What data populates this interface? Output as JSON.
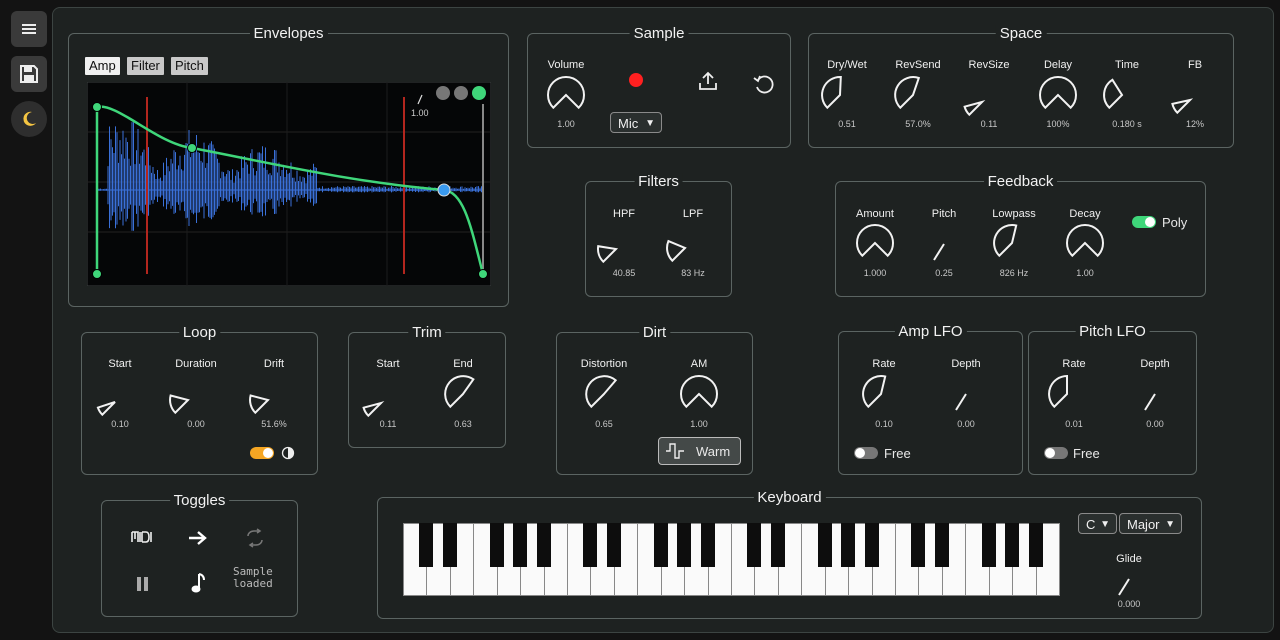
{
  "colors": {
    "accent_green": "#3fd67a",
    "accent_blue": "#3a9af0",
    "record_red": "#ff2020",
    "toggle_orange": "#f5a623",
    "waveform": "#3a70d8",
    "marker_red": "#b3261e"
  },
  "sidebar": {
    "menu_icon": "hamburger-icon",
    "save_icon": "floppy-disk-icon",
    "theme_icon": "crescent-moon-icon"
  },
  "envelopes": {
    "title": "Envelopes",
    "tabs": [
      "Amp",
      "Filter",
      "Pitch"
    ],
    "active_tab": "Amp",
    "readout": "1.00"
  },
  "sample": {
    "title": "Sample",
    "volume_label": "Volume",
    "volume_value": "1.00",
    "source": "Mic",
    "record_icon": "record-icon",
    "upload_icon": "upload-icon",
    "undo_icon": "undo-icon"
  },
  "space": {
    "title": "Space",
    "knobs": [
      {
        "label": "Dry/Wet",
        "value": "0.51"
      },
      {
        "label": "RevSend",
        "value": "57.0%"
      },
      {
        "label": "RevSize",
        "value": "0.11"
      },
      {
        "label": "Delay",
        "value": "100%"
      },
      {
        "label": "Time",
        "value": "0.180 s"
      },
      {
        "label": "FB",
        "value": "12%"
      }
    ]
  },
  "filters": {
    "title": "Filters",
    "knobs": [
      {
        "label": "HPF",
        "value": "40.85"
      },
      {
        "label": "LPF",
        "value": "83 Hz"
      }
    ]
  },
  "feedback": {
    "title": "Feedback",
    "knobs": [
      {
        "label": "Amount",
        "value": "1.000"
      },
      {
        "label": "Pitch",
        "value": "0.25"
      },
      {
        "label": "Lowpass",
        "value": "826 Hz"
      },
      {
        "label": "Decay",
        "value": "1.00"
      }
    ],
    "poly_label": "Poly",
    "poly_on": true
  },
  "loop": {
    "title": "Loop",
    "knobs": [
      {
        "label": "Start",
        "value": "0.10"
      },
      {
        "label": "Duration",
        "value": "0.00"
      },
      {
        "label": "Drift",
        "value": "51.6%"
      }
    ],
    "toggle_on": true,
    "contrast_icon": "half-circle-icon"
  },
  "trim": {
    "title": "Trim",
    "knobs": [
      {
        "label": "Start",
        "value": "0.11"
      },
      {
        "label": "End",
        "value": "0.63"
      }
    ]
  },
  "dirt": {
    "title": "Dirt",
    "knobs": [
      {
        "label": "Distortion",
        "value": "0.65"
      },
      {
        "label": "AM",
        "value": "1.00"
      }
    ],
    "warm_label": "Warm",
    "warm_icon": "square-wave-icon"
  },
  "amp_lfo": {
    "title": "Amp LFO",
    "knobs": [
      {
        "label": "Rate",
        "value": "0.10"
      },
      {
        "label": "Depth",
        "value": "0.00"
      }
    ],
    "free_label": "Free",
    "free_on": false
  },
  "pitch_lfo": {
    "title": "Pitch LFO",
    "knobs": [
      {
        "label": "Rate",
        "value": "0.01"
      },
      {
        "label": "Depth",
        "value": "0.00"
      }
    ],
    "free_label": "Free",
    "free_on": false
  },
  "toggles": {
    "title": "Toggles",
    "midi_icon": "midi-icon",
    "arrow_icon": "arrow-right-icon",
    "loop_icon": "repeat-icon",
    "pause_icon": "pause-icon",
    "note_icon": "music-note-icon",
    "status_line1": "Sample",
    "status_line2": "loaded"
  },
  "keyboard": {
    "title": "Keyboard",
    "root_note": "C",
    "scale": "Major",
    "glide_label": "Glide",
    "glide_value": "0.000",
    "white_key_count": 28
  }
}
